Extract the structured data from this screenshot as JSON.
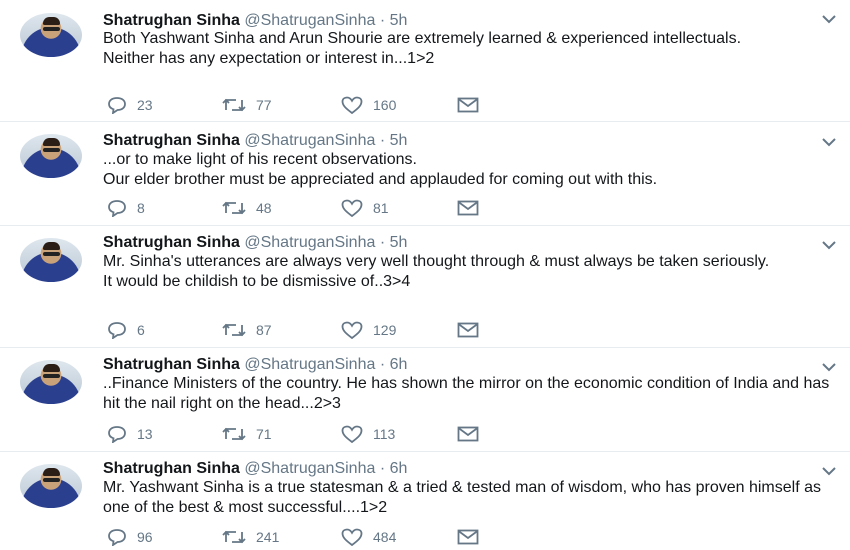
{
  "tweets": [
    {
      "name": "Shatrughan Sinha",
      "handle": "@ShatruganSinha",
      "dot": "·",
      "time": "5h",
      "text": "Both Yashwant Sinha and Arun Shourie are extremely learned & experienced intellectuals.\nNeither has any expectation or interest in...1>2",
      "replies": "23",
      "retweets": "77",
      "likes": "160"
    },
    {
      "name": "Shatrughan Sinha",
      "handle": "@ShatruganSinha",
      "dot": "·",
      "time": "5h",
      "text": "...or to make light of his recent observations.\nOur elder brother must be appreciated and applauded for coming out with this.",
      "replies": "8",
      "retweets": "48",
      "likes": "81"
    },
    {
      "name": "Shatrughan Sinha",
      "handle": "@ShatruganSinha",
      "dot": "·",
      "time": "5h",
      "text": "Mr. Sinha's utterances are always very well thought through & must always be taken seriously.\nIt would be childish to be dismissive of..3>4",
      "replies": "6",
      "retweets": "87",
      "likes": "129"
    },
    {
      "name": "Shatrughan Sinha",
      "handle": "@ShatruganSinha",
      "dot": "·",
      "time": "6h",
      "text": "..Finance Ministers of the country. He has shown the mirror on the economic condition of India and has hit the nail right on the head...2>3",
      "replies": "13",
      "retweets": "71",
      "likes": "113"
    },
    {
      "name": "Shatrughan Sinha",
      "handle": "@ShatruganSinha",
      "dot": "·",
      "time": "6h",
      "text": "Mr. Yashwant Sinha is a true statesman & a tried & tested man of wisdom, who has proven himself as one of the best & most successful....1>2",
      "replies": "96",
      "retweets": "241",
      "likes": "484"
    }
  ],
  "icons": {
    "reply": "reply-icon",
    "retweet": "retweet-icon",
    "like": "heart-icon",
    "dm": "envelope-icon",
    "menu": "chevron-down-icon"
  },
  "colors": {
    "text": "#14171a",
    "muted": "#657786",
    "divider": "#e6ecf0"
  }
}
